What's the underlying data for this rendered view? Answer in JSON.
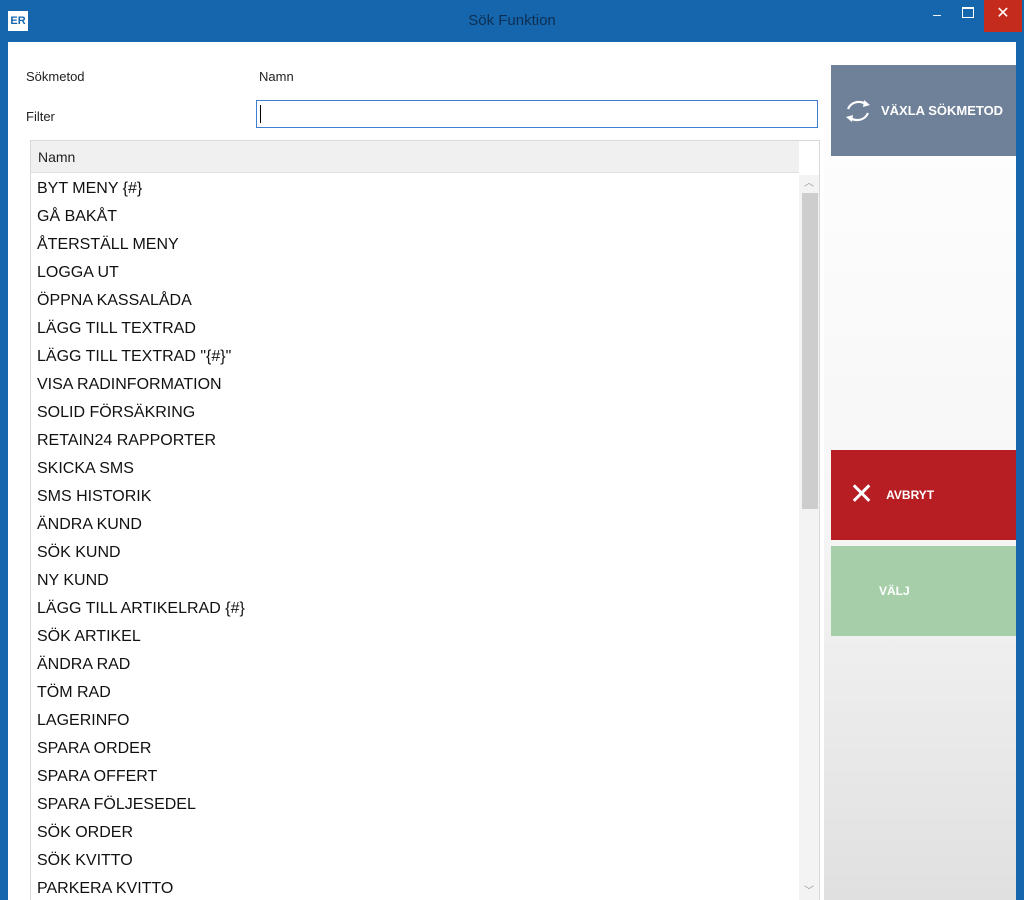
{
  "window": {
    "app_icon_text": "ER",
    "title": "Sök Funktion",
    "minimize": "–",
    "close": "✕"
  },
  "form": {
    "method_label": "Sökmetod",
    "method_value": "Namn",
    "filter_label": "Filter",
    "filter_value": ""
  },
  "list": {
    "header": "Namn",
    "items": [
      "BYT MENY {#}",
      "GÅ BAKÅT",
      "ÅTERSTÄLL MENY",
      "LOGGA UT",
      "ÖPPNA KASSALÅDA",
      "LÄGG TILL TEXTRAD",
      "LÄGG TILL TEXTRAD \"{#}\"",
      "VISA RADINFORMATION",
      "SOLID FÖRSÄKRING",
      "RETAIN24 RAPPORTER",
      "SKICKA SMS",
      "SMS HISTORIK",
      "ÄNDRA KUND",
      "SÖK KUND",
      "NY KUND",
      "LÄGG TILL ARTIKELRAD {#}",
      "SÖK ARTIKEL",
      "ÄNDRA RAD",
      "TÖM RAD",
      "LAGERINFO",
      "SPARA ORDER",
      "SPARA OFFERT",
      "SPARA FÖLJESEDEL",
      "SÖK ORDER",
      "SÖK KVITTO",
      "PARKERA KVITTO"
    ]
  },
  "buttons": {
    "switch": "VÄXLA SÖKMETOD",
    "cancel": "AVBRYT",
    "choose": "VÄLJ"
  },
  "colors": {
    "titlebar": "#1566ad",
    "switch_button": "#6f8199",
    "cancel_button": "#b61e24",
    "choose_button": "#a6cfa9",
    "close_button": "#c42b1c"
  },
  "icons": {
    "switch": "swap-arrows-icon",
    "cancel": "x-icon"
  }
}
